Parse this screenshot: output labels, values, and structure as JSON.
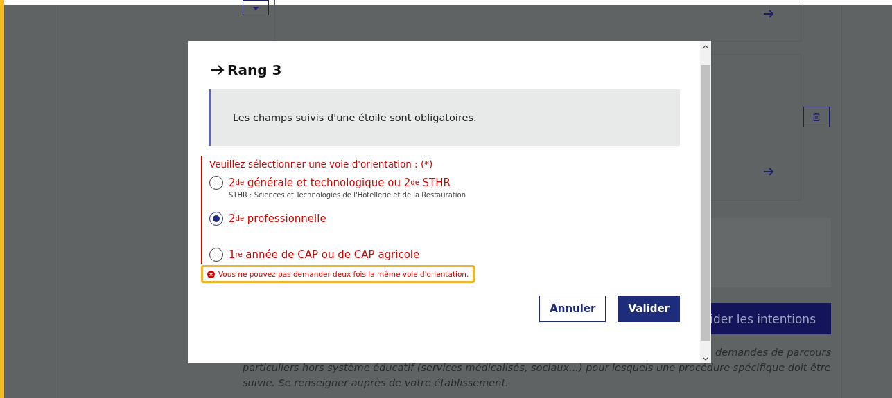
{
  "background": {
    "cards": [
      {
        "kind": "arrow"
      },
      {
        "kind": "arrow-delete"
      }
    ],
    "submit_button_partial": "ider les intentions",
    "note_lines": [
      "demandes de parcours",
      "particuliers hors système éducatif (services médicalisés, sociaux...) pour lesquels une procédure spécifique doit être",
      "suivie. Se renseigner auprès de votre établissement."
    ]
  },
  "modal": {
    "title": "Rang 3",
    "notice": "Les champs suivis d'une étoile sont obligatoires.",
    "fieldset": {
      "legend": "Veuillez sélectionner une voie d'orientation : (*)",
      "invalid": true,
      "options": [
        {
          "label": "2$^{de}$ générale et technologique ou 2$^{de}$ STHR",
          "hint": "STHR : Sciences et Technologies de l'Hôtellerie et de la Restauration",
          "selected": false
        },
        {
          "label": "2$^{de}$ professionnelle",
          "selected": true
        },
        {
          "label": "1$^{re}$ année de CAP ou de CAP agricole",
          "selected": false
        }
      ],
      "error": "Vous ne pouvez pas demander deux fois la même voie d'orientation.",
      "error_highlighted": true
    },
    "buttons": [
      {
        "label": "Annuler",
        "kind": "secondary"
      },
      {
        "label": "Valider",
        "kind": "primary"
      }
    ]
  }
}
